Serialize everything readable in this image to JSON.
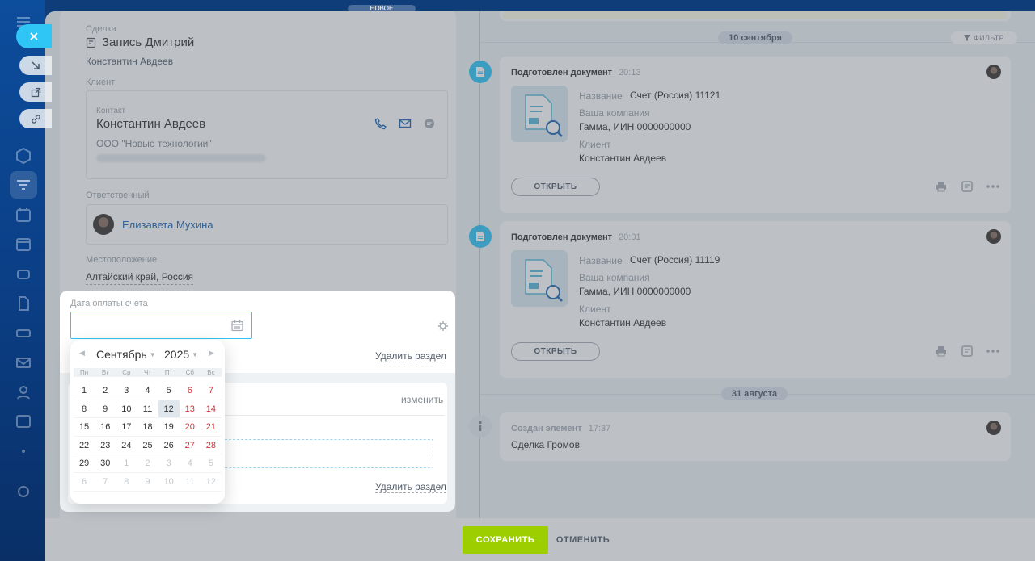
{
  "top_badge": "НОВОЕ",
  "deal": {
    "section_label": "Сделка",
    "title": "Запись Дмитрий",
    "owner": "Константин Авдеев"
  },
  "client": {
    "label": "Клиент",
    "contact_label": "Контакт",
    "contact_name": "Константин Авдеев",
    "company": "ООО \"Новые технологии\""
  },
  "responsible": {
    "label": "Ответственный",
    "name": "Елизавета Мухина"
  },
  "location": {
    "label": "Местоположение",
    "value": "Алтайский край, Россия"
  },
  "payment_section": {
    "label": "Дата оплаты счета",
    "date_value": "",
    "delete_label": "Удалить раздел",
    "change_label": "изменить",
    "delete_label_2": "Удалить раздел"
  },
  "calendar": {
    "month": "Сентябрь",
    "year": "2025",
    "weekdays": [
      "Пн",
      "Вт",
      "Ср",
      "Чт",
      "Пт",
      "Сб",
      "Вс"
    ],
    "days": [
      [
        "1",
        "2",
        "3",
        "4",
        "5",
        "6",
        "7"
      ],
      [
        "8",
        "9",
        "10",
        "11",
        "12",
        "13",
        "14"
      ],
      [
        "15",
        "16",
        "17",
        "18",
        "19",
        "20",
        "21"
      ],
      [
        "22",
        "23",
        "24",
        "25",
        "26",
        "27",
        "28"
      ],
      [
        "29",
        "30",
        "1",
        "2",
        "3",
        "4",
        "5"
      ],
      [
        "6",
        "7",
        "8",
        "9",
        "10",
        "11",
        "12"
      ]
    ],
    "today": "12",
    "weekend_color": "#d0323c"
  },
  "timeline": {
    "filter_label": "ФИЛЬТР",
    "date1": "10 сентября",
    "date2": "31 августа",
    "items": [
      {
        "title": "Подготовлен документ",
        "time": "20:13",
        "name_label": "Название",
        "name_value": "Счет (Россия) 11121",
        "company_label": "Ваша компания",
        "company_value": "Гамма, ИИН 0000000000",
        "client_label": "Клиент",
        "client_value": "Константин Авдеев",
        "open_label": "ОТКРЫТЬ"
      },
      {
        "title": "Подготовлен документ",
        "time": "20:01",
        "name_label": "Название",
        "name_value": "Счет (Россия) 11119",
        "company_label": "Ваша компания",
        "company_value": "Гамма, ИИН 0000000000",
        "client_label": "Клиент",
        "client_value": "Константин Авдеев",
        "open_label": "ОТКРЫТЬ"
      },
      {
        "title": "Создан элемент",
        "time": "17:37",
        "text": "Сделка Громов"
      }
    ]
  },
  "footer": {
    "save_label": "СОХРАНИТЬ",
    "cancel_label": "ОТМЕНИТЬ"
  },
  "colors": {
    "accent": "#2fc6f6",
    "save": "#9dcf00",
    "link": "#2067b0"
  }
}
